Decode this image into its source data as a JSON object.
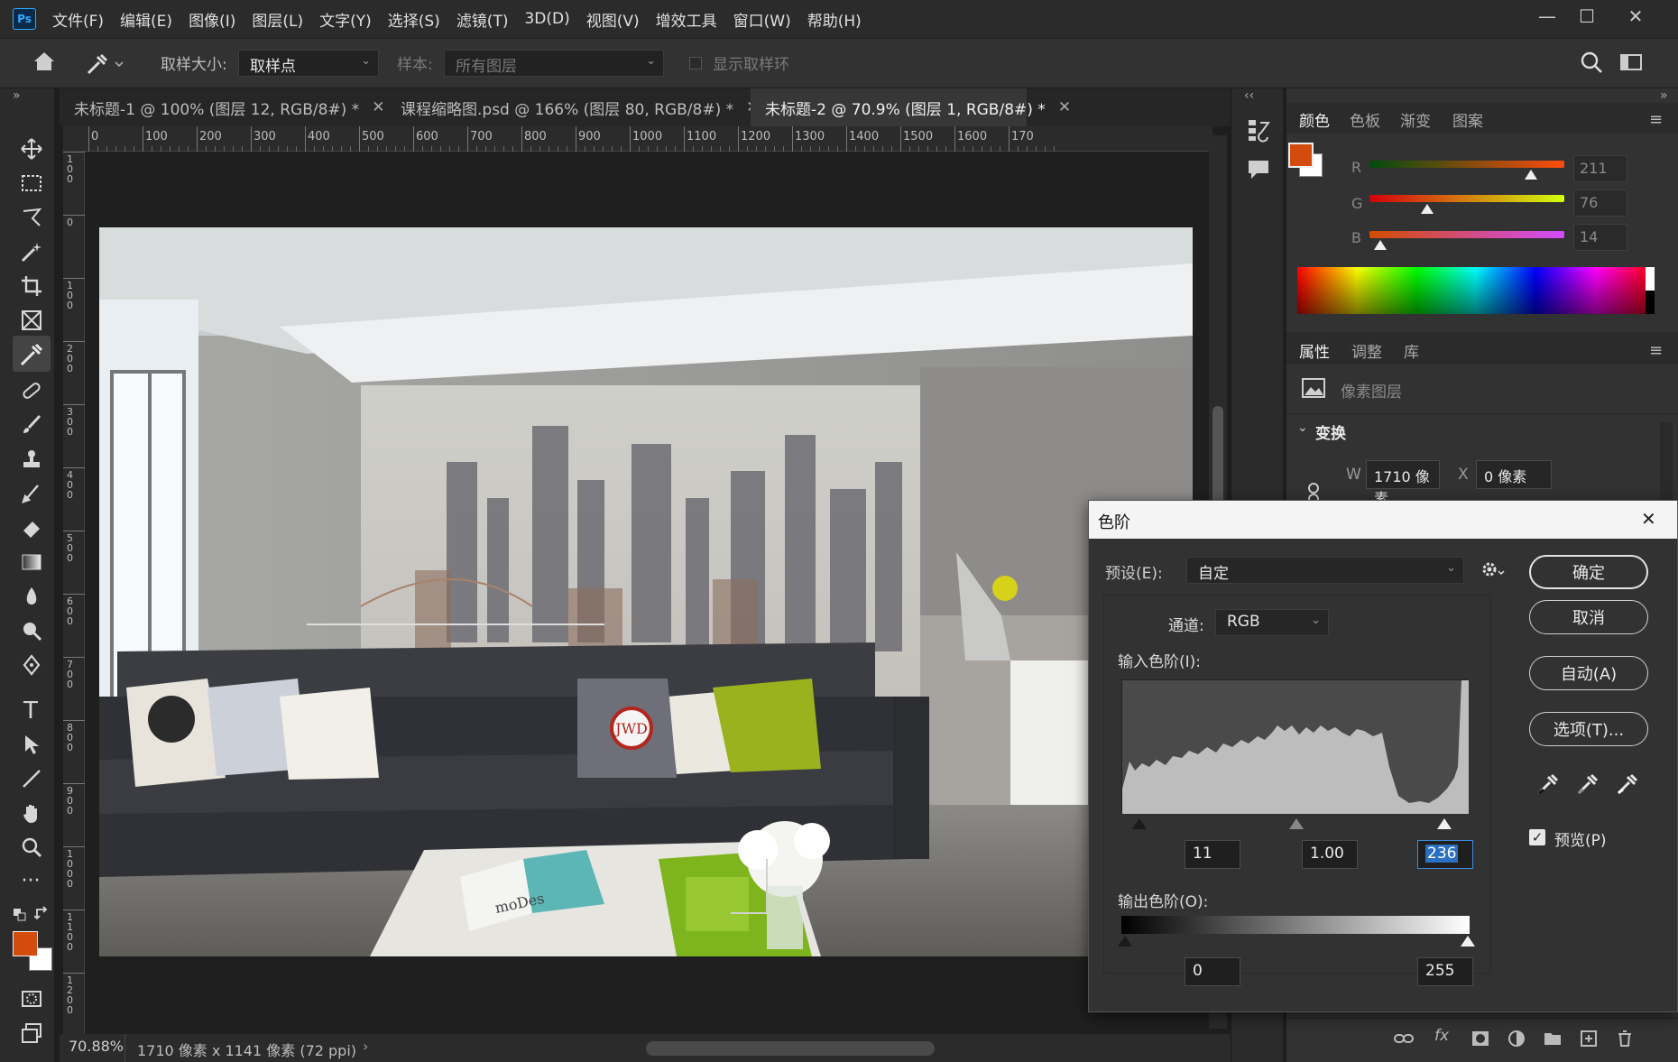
{
  "app": {
    "logo": "Ps"
  },
  "menu": [
    "文件(F)",
    "编辑(E)",
    "图像(I)",
    "图层(L)",
    "文字(Y)",
    "选择(S)",
    "滤镜(T)",
    "3D(D)",
    "视图(V)",
    "增效工具",
    "窗口(W)",
    "帮助(H)"
  ],
  "window_controls": {
    "minimize": "—",
    "maximize": "☐",
    "close": "✕"
  },
  "options": {
    "sample_size_label": "取样大小:",
    "sample_size_value": "取样点",
    "sample_label": "样本:",
    "sample_value": "所有图层",
    "show_ring_label": "显示取样环"
  },
  "tabs": [
    {
      "label": "未标题-1 @ 100% (图层 12, RGB/8#) *",
      "close": "✕",
      "active": false
    },
    {
      "label": "课程缩略图.psd @ 166% (图层 80, RGB/8#) *",
      "close": "✕",
      "active": false
    },
    {
      "label": "未标题-2 @ 70.9% (图层 1, RGB/8#) *",
      "close": "✕",
      "active": true
    }
  ],
  "ruler": {
    "h_ticks": [
      "0",
      "100",
      "200",
      "300",
      "400",
      "500",
      "600",
      "700",
      "800",
      "900",
      "1000",
      "1100",
      "1200",
      "1300",
      "1400",
      "1500",
      "1600",
      "170"
    ],
    "v_ticks": [
      "1 0 0",
      "0",
      "1 0 0",
      "2 0 0",
      "3 0 0",
      "4 0 0",
      "5 0 0",
      "6 0 0",
      "7 0 0",
      "8 0 0",
      "9 0 0",
      "1 0 0 0",
      "1 1 0 0",
      "1 2 0 0"
    ]
  },
  "status": {
    "zoom": "70.88%",
    "doc_info": "1710 像素 x 1141 像素 (72 ppi)",
    "arrow": "›"
  },
  "photo": {
    "cushion_text": "JWD",
    "magazine_text": "moDes"
  },
  "color_panel": {
    "tabs": [
      "颜色",
      "色板",
      "渐变",
      "图案"
    ],
    "r_label": "R",
    "g_label": "G",
    "b_label": "B",
    "r": "211",
    "g": "76",
    "b": "14",
    "r_fraction": 0.827,
    "g_fraction": 0.298,
    "b_fraction": 0.055,
    "foreground_color": "#d34c0e",
    "background_color": "#ffffff"
  },
  "properties_panel": {
    "tabs": [
      "属性",
      "调整",
      "库"
    ],
    "layer_type": "像素图层",
    "section": "变换",
    "w_label": "W",
    "w_value": "1710 像素",
    "x_label": "X",
    "x_value": "0 像素"
  },
  "levels_dialog": {
    "title": "色阶",
    "close": "✕",
    "preset_label": "预设(E):",
    "preset_value": "自定",
    "channel_label": "通道:",
    "channel_value": "RGB",
    "input_label": "输入色阶(I):",
    "input_black": "11",
    "input_gamma": "1.00",
    "input_white": "236",
    "output_label": "输出色阶(O):",
    "output_black": "0",
    "output_white": "255",
    "buttons": {
      "ok": "确定",
      "cancel": "取消",
      "auto": "自动(A)",
      "options": "选项(T)..."
    },
    "preview_label": "预览(P)",
    "preview_checked": true
  }
}
